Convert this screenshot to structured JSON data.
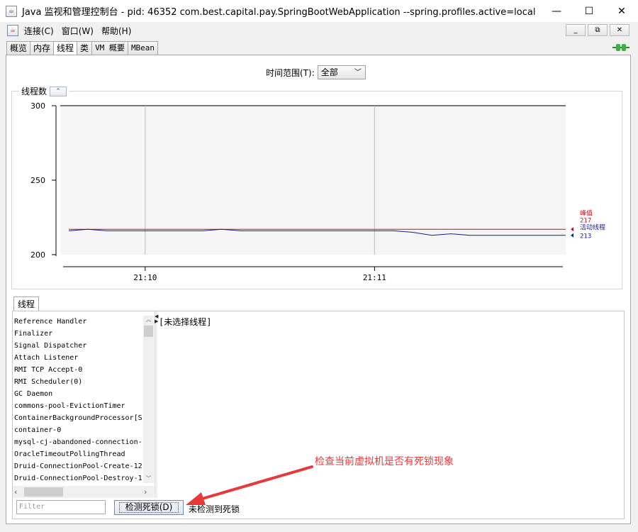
{
  "window": {
    "title": "Java 监视和管理控制台 - pid: 46352 com.best.capital.pay.SpringBootWebApplication --spring.profiles.active=local",
    "minimize": "—",
    "maximize": "☐",
    "close": "✕"
  },
  "menu": {
    "items": [
      "连接(C)",
      "窗口(W)",
      "帮助(H)"
    ]
  },
  "mdi": {
    "minimize": "_",
    "restore": "⧉",
    "close": "✕"
  },
  "tabs": [
    "概览",
    "内存",
    "线程",
    "类",
    "VM 概要",
    "MBean"
  ],
  "active_tab": "线程",
  "time_range": {
    "label": "时间范围(T):",
    "value": "全部"
  },
  "chart_panel": {
    "title": "线程数",
    "collapse_icon": "⌃"
  },
  "chart_data": {
    "type": "line",
    "x": [
      "21:09:40",
      "21:09:45",
      "21:09:50",
      "21:09:55",
      "21:10:00",
      "21:10:05",
      "21:10:10",
      "21:10:15",
      "21:10:20",
      "21:10:25",
      "21:10:30",
      "21:10:35",
      "21:10:40",
      "21:10:45",
      "21:10:50",
      "21:10:55",
      "21:11:00",
      "21:11:05",
      "21:11:10",
      "21:11:15",
      "21:11:20",
      "21:11:25",
      "21:11:30",
      "21:11:35",
      "21:11:40",
      "21:11:45",
      "21:11:50"
    ],
    "xticks": [
      "21:10",
      "21:11"
    ],
    "yticks": [
      "200",
      "250",
      "300"
    ],
    "ylim": [
      200,
      300
    ],
    "series": [
      {
        "name": "峰值",
        "color": "#c0111f",
        "last_value": "217",
        "values": [
          217,
          217,
          217,
          217,
          217,
          217,
          217,
          217,
          217,
          217,
          217,
          217,
          217,
          217,
          217,
          217,
          217,
          217,
          217,
          217,
          217,
          217,
          217,
          217,
          217,
          217,
          217
        ]
      },
      {
        "name": "活动线程",
        "color": "#1a1a8c",
        "last_value": "213",
        "values": [
          216,
          217,
          216,
          216,
          216,
          216,
          216,
          216,
          217,
          216,
          216,
          216,
          216,
          216,
          216,
          216,
          216,
          216,
          215,
          213,
          214,
          213,
          213,
          213,
          213,
          213,
          213
        ]
      }
    ]
  },
  "threads_panel": {
    "tab": "线程",
    "items": [
      "Reference Handler",
      "Finalizer",
      "Signal Dispatcher",
      "Attach Listener",
      "RMI TCP Accept-0",
      "RMI Scheduler(0)",
      "GC Daemon",
      "commons-pool-EvictionTimer",
      "ContainerBackgroundProcessor[S",
      "container-0",
      "mysql-cj-abandoned-connection-",
      "OracleTimeoutPollingThread",
      "Druid-ConnectionPool-Create-12",
      "Druid-ConnectionPool-Destroy-1"
    ],
    "detail": "[未选择线程]",
    "filter_placeholder": "Filter",
    "deadlock_button": "检测死锁(D)",
    "deadlock_status": "未检测到死锁"
  },
  "annotation": {
    "text": "检查当前虚拟机是否有死锁现象",
    "color": "#e8393a"
  }
}
